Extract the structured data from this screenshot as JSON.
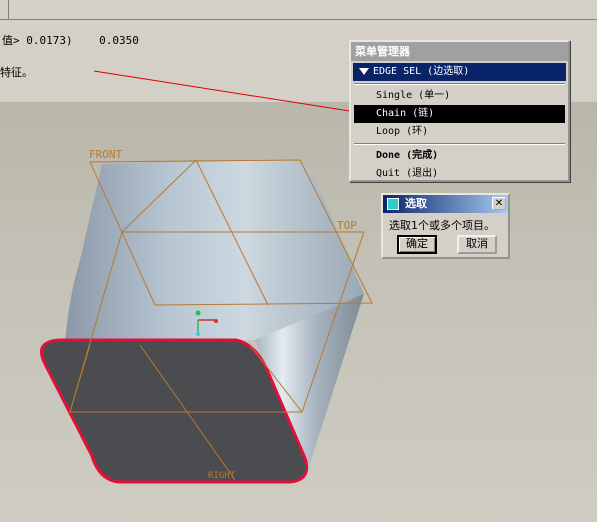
{
  "message_area": {
    "line1": "值> 0.0173)    0.0350",
    "line2": "特征。"
  },
  "menu_manager": {
    "title": "菜单管理器",
    "header": "EDGE SEL (边选取)",
    "items": [
      {
        "label": "Single (单一)"
      },
      {
        "label": "Chain (链)",
        "selected": true
      },
      {
        "label": "Loop (环)"
      },
      {
        "label": "Done (完成)",
        "bold": true
      },
      {
        "label": "Quit (退出)"
      }
    ]
  },
  "select_dialog": {
    "title": "选取",
    "prompt": "选取1个或多个项目。",
    "ok_label": "确定",
    "cancel_label": "取消",
    "close_glyph": "✕"
  },
  "model": {
    "datum_labels": {
      "front": "FRONT",
      "top": "TOP",
      "right": "RIGHT"
    },
    "colors": {
      "highlight_edge": "#e0103a",
      "datum": "#b87830",
      "selection": "#0a246a"
    }
  }
}
